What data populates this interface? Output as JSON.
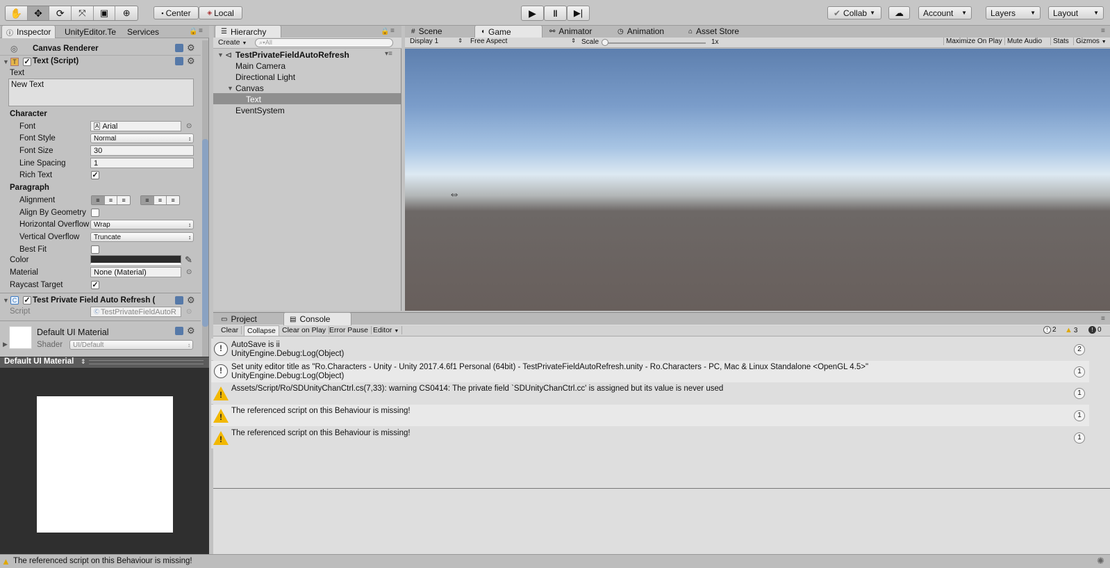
{
  "toolbar": {
    "tools": [
      "hand-tool",
      "move-tool",
      "rotate-tool",
      "scale-tool",
      "rect-tool",
      "transform-tool"
    ],
    "pivot": "Center",
    "space": "Local",
    "collab": "Collab",
    "account": "Account",
    "layers": "Layers",
    "layout": "Layout"
  },
  "inspector": {
    "tabs": [
      "Inspector",
      "UnityEditor.Te",
      "Services"
    ],
    "canvas_renderer": "Canvas Renderer",
    "text_component": "Text (Script)",
    "text_label": "Text",
    "text_value": "New Text",
    "character_header": "Character",
    "font_label": "Font",
    "font_value": "Arial",
    "font_style_label": "Font Style",
    "font_style_value": "Normal",
    "font_size_label": "Font Size",
    "font_size_value": "30",
    "line_spacing_label": "Line Spacing",
    "line_spacing_value": "1",
    "rich_text_label": "Rich Text",
    "paragraph_header": "Paragraph",
    "alignment_label": "Alignment",
    "align_by_geometry_label": "Align By Geometry",
    "horizontal_overflow_label": "Horizontal Overflow",
    "horizontal_overflow_value": "Wrap",
    "vertical_overflow_label": "Vertical Overflow",
    "vertical_overflow_value": "Truncate",
    "best_fit_label": "Best Fit",
    "color_label": "Color",
    "color_value": "#2b2b2b",
    "material_label": "Material",
    "material_value": "None (Material)",
    "raycast_label": "Raycast Target",
    "test_component": "Test Private Field Auto Refresh (",
    "script_label": "Script",
    "script_value": "TestPrivateFieldAutoR",
    "material_name": "Default UI Material",
    "shader_label": "Shader",
    "shader_value": "UI/Default",
    "preview_title": "Default UI Material"
  },
  "hierarchy": {
    "tab": "Hierarchy",
    "create": "Create",
    "search_placeholder": "All",
    "scene": "TestPrivateFieldAutoRefresh",
    "items": [
      "Main Camera",
      "Directional Light",
      "Canvas",
      "Text",
      "EventSystem"
    ]
  },
  "game": {
    "tabs": [
      "Scene",
      "Game",
      "Animator",
      "Animation",
      "Asset Store"
    ],
    "display": "Display 1",
    "aspect": "Free Aspect",
    "scale_label": "Scale",
    "scale_value": "1x",
    "buttons": [
      "Maximize On Play",
      "Mute Audio",
      "Stats",
      "Gizmos"
    ]
  },
  "console": {
    "tabs": [
      "Project",
      "Console"
    ],
    "buttons": [
      "Clear",
      "Collapse",
      "Clear on Play",
      "Error Pause",
      "Editor"
    ],
    "counts": {
      "info": "2",
      "warn": "3",
      "error": "0"
    },
    "rows": [
      {
        "type": "info",
        "line1": "AutoSave is ii",
        "line2": "UnityEngine.Debug:Log(Object)",
        "count": "2"
      },
      {
        "type": "info",
        "line1": "Set unity editor title as \"Ro.Characters - Unity - Unity 2017.4.6f1 Personal (64bit) - TestPrivateFieldAutoRefresh.unity - Ro.Characters - PC, Mac & Linux Standalone <OpenGL 4.5>\"",
        "line2": "UnityEngine.Debug:Log(Object)",
        "count": "1"
      },
      {
        "type": "warn",
        "line1": "Assets/Script/Ro/SDUnityChanCtrl.cs(7,33): warning CS0414: The private field `SDUnityChanCtrl.cc' is assigned but its value is never used",
        "line2": "",
        "count": "1"
      },
      {
        "type": "warn",
        "line1": "The referenced script on this Behaviour is missing!",
        "line2": "",
        "count": "1"
      },
      {
        "type": "warn",
        "line1": "The referenced script on this Behaviour is missing!",
        "line2": "",
        "count": "1"
      }
    ]
  },
  "status_bar": "The referenced script on this Behaviour is missing!"
}
